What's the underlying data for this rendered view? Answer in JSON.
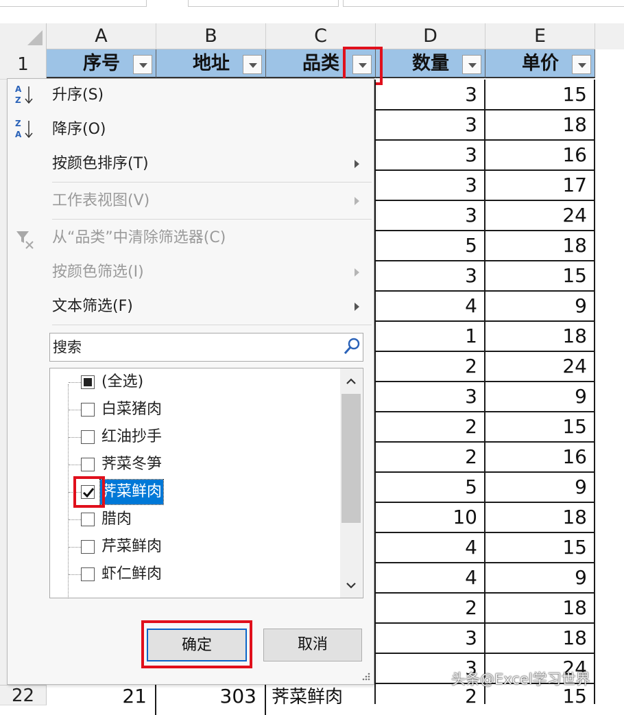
{
  "columns": [
    "A",
    "B",
    "C",
    "D",
    "E"
  ],
  "header_row_number": "1",
  "headers": [
    "序号",
    "地址",
    "品类",
    "数量",
    "单价"
  ],
  "data_rows": [
    {
      "qty": "3",
      "price": "15"
    },
    {
      "qty": "3",
      "price": "18"
    },
    {
      "qty": "3",
      "price": "16"
    },
    {
      "qty": "3",
      "price": "17"
    },
    {
      "qty": "3",
      "price": "24"
    },
    {
      "qty": "5",
      "price": "18"
    },
    {
      "qty": "3",
      "price": "15"
    },
    {
      "qty": "4",
      "price": "9"
    },
    {
      "qty": "1",
      "price": "18"
    },
    {
      "qty": "2",
      "price": "24"
    },
    {
      "qty": "3",
      "price": "9"
    },
    {
      "qty": "2",
      "price": "15"
    },
    {
      "qty": "2",
      "price": "16"
    },
    {
      "qty": "5",
      "price": "9"
    },
    {
      "qty": "10",
      "price": "18"
    },
    {
      "qty": "4",
      "price": "15"
    },
    {
      "qty": "4",
      "price": "9"
    },
    {
      "qty": "2",
      "price": "18"
    },
    {
      "qty": "3",
      "price": "18"
    },
    {
      "qty": "3",
      "price": "24"
    }
  ],
  "last_row": {
    "rownum": "22",
    "a": "21",
    "b": "303",
    "c": "荠菜鲜肉",
    "d": "2",
    "e": "15"
  },
  "menu": {
    "sort_asc": "升序(S)",
    "sort_desc": "降序(O)",
    "sort_by_color": "按颜色排序(T)",
    "sheet_view": "工作表视图(V)",
    "clear_filter": "从“品类”中清除筛选器(C)",
    "filter_by_color": "按颜色筛选(I)",
    "text_filter": "文本筛选(F)"
  },
  "search_placeholder": "搜索",
  "list_items": [
    {
      "label": "(全选)",
      "state": "partial"
    },
    {
      "label": "白菜猪肉",
      "state": "unchecked"
    },
    {
      "label": "红油抄手",
      "state": "unchecked"
    },
    {
      "label": "荠菜冬笋",
      "state": "unchecked"
    },
    {
      "label": "荠菜鲜肉",
      "state": "checked"
    },
    {
      "label": "腊肉",
      "state": "unchecked"
    },
    {
      "label": "芹菜鲜肉",
      "state": "unchecked"
    },
    {
      "label": "虾仁鲜肉",
      "state": "unchecked"
    }
  ],
  "buttons": {
    "ok": "确定",
    "cancel": "取消"
  },
  "watermark": "头条@Excel学习世界",
  "colors": {
    "header_fill": "#9dc3e6",
    "highlight": "#e0101c",
    "selection": "#0078d7"
  }
}
